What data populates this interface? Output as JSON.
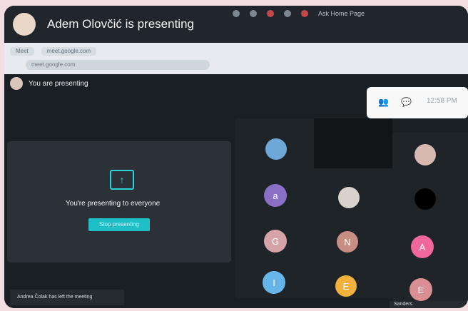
{
  "header": {
    "presenter_title": "Adem Olovčić is presenting"
  },
  "bookmarks": [
    "Ask Home Page"
  ],
  "browser": {
    "tabs": [
      "Meet",
      "meet.google.com"
    ],
    "url": "meet.google.com"
  },
  "meeting": {
    "you_are_presenting": "You are presenting",
    "presenting_message": "You're presenting to everyone",
    "stop_button": "Stop presenting",
    "toast_left": "Andrea Čolak has left the meeting",
    "toast_right": "Sanders"
  },
  "controls": {
    "time": "12:58 PM"
  },
  "participants": [
    {
      "letter": "a",
      "color": "#8a6fc4"
    },
    {
      "letter": "G",
      "color": "#d6a3a8"
    },
    {
      "letter": "I",
      "color": "#66b4e8"
    },
    {
      "letter": "N",
      "color": "#c78f84"
    },
    {
      "letter": "E",
      "color": "#f0b23a"
    },
    {
      "letter": "A",
      "color": "#f0679b"
    },
    {
      "letter": "E",
      "color": "#d98f93"
    }
  ]
}
